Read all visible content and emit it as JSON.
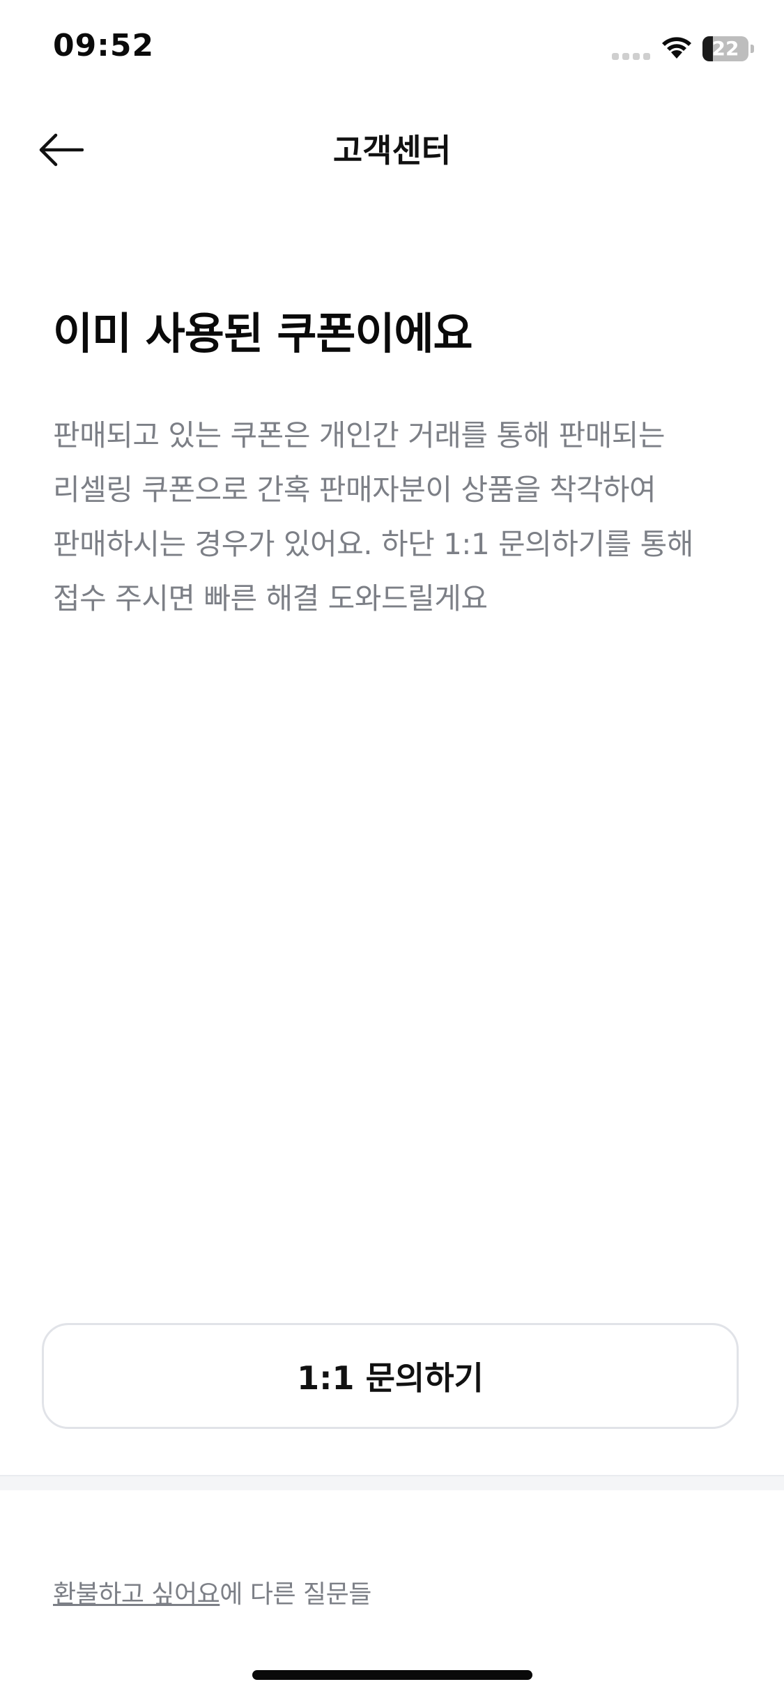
{
  "status_bar": {
    "time": "09:52",
    "battery_level": "22",
    "battery_fraction": 0.22
  },
  "header": {
    "back_icon": "arrow-left-icon",
    "title": "고객센터"
  },
  "main": {
    "headline": "이미 사용된 쿠폰이에요",
    "body": "판매되고 있는 쿠폰은 개인간 거래를 통해 판매되는 리셀링 쿠폰으로 간혹 판매자분이 상품을 착각하여 판매하시는 경우가 있어요. 하단 1:1 문의하기를 통해 접수 주시면 빠른 해결 도와드릴게요",
    "inquiry_button_label": "1:1 문의하기"
  },
  "footer": {
    "related_link": "환불하고 싶어요",
    "related_suffix": "에 다른 질문들"
  },
  "colors": {
    "body_text": "#7c7f86",
    "button_border": "#e1e3e8",
    "divider": "#f4f5f7"
  }
}
